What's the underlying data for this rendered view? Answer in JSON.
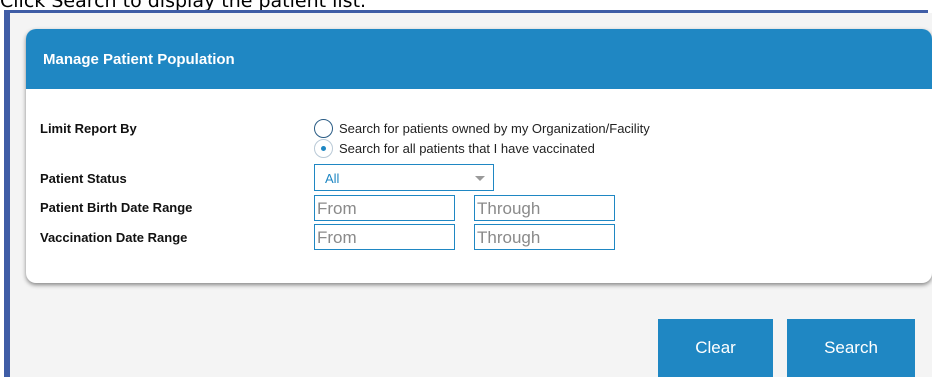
{
  "caption": "Click Search to display the patient list.",
  "card": {
    "title": "Manage Patient Population"
  },
  "form": {
    "limit_report_label": "Limit Report By",
    "radio_options": [
      {
        "label": "Search for patients owned by my Organization/Facility",
        "checked": false
      },
      {
        "label": "Search for all patients that I have vaccinated",
        "checked": true
      }
    ],
    "patient_status_label": "Patient Status",
    "patient_status_value": "All",
    "birth_date_label": "Patient Birth Date Range",
    "vaccination_date_label": "Vaccination Date Range",
    "from_placeholder": "From",
    "through_placeholder": "Through"
  },
  "buttons": {
    "clear": "Clear",
    "search": "Search"
  },
  "colors": {
    "accent": "#1f87c3",
    "frame": "#3f5da6"
  }
}
